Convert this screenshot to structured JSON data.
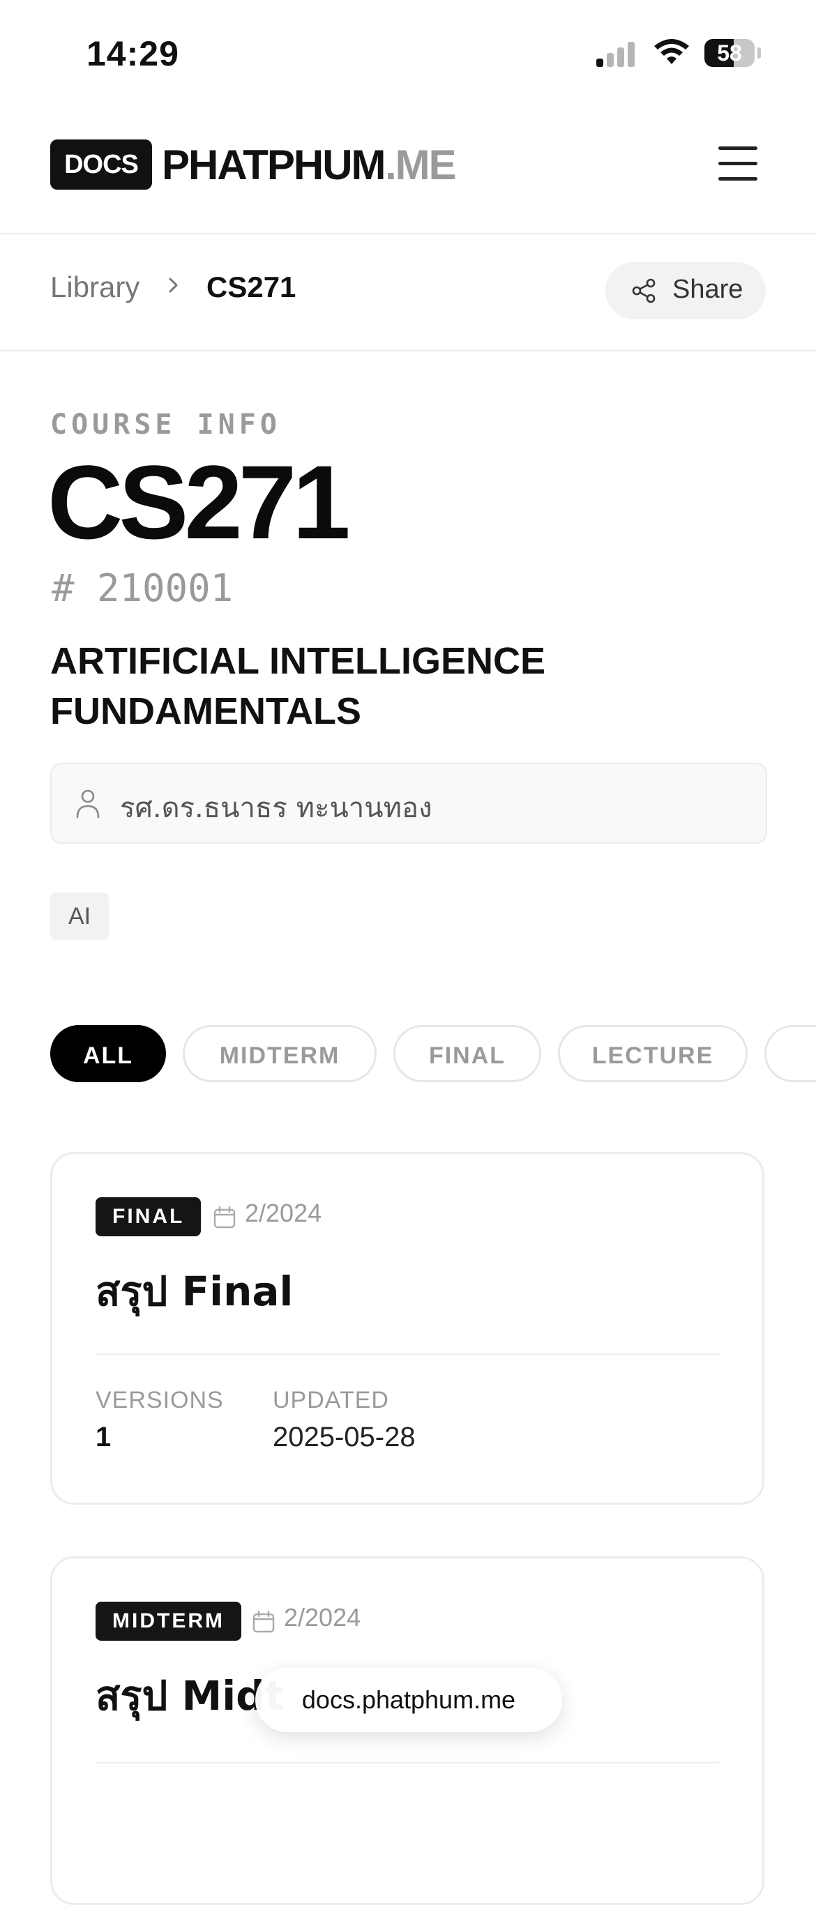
{
  "status_bar": {
    "time": "14:29",
    "battery": "58",
    "battery_level": 0.58
  },
  "header": {
    "logo_badge": "DOCS",
    "logo_main": "PHATPHUM",
    "logo_suffix": ".ME"
  },
  "breadcrumb": {
    "library": "Library",
    "current": "CS271",
    "share_label": "Share"
  },
  "course": {
    "section_label": "COURSE INFO",
    "code": "CS271",
    "id_hash": "#",
    "id": "210001",
    "title_line1": "ARTIFICIAL INTELLIGENCE",
    "title_line2": "FUNDAMENTALS",
    "instructor": "รศ.ดร.ธนาธร ทะนานทอง",
    "tag": "AI"
  },
  "filters": [
    "ALL",
    "MIDTERM",
    "FINAL",
    "LECTURE"
  ],
  "cards": [
    {
      "badge": "FINAL",
      "term": "2/2024",
      "title": "สรุป Final",
      "versions_label": "VERSIONS",
      "versions": "1",
      "updated_label": "UPDATED",
      "updated": "2025-05-28"
    },
    {
      "badge": "MIDTERM",
      "term": "2/2024",
      "title": "สรุป Midt"
    }
  ],
  "url_bar": {
    "domain": "docs.phatphum.me"
  }
}
